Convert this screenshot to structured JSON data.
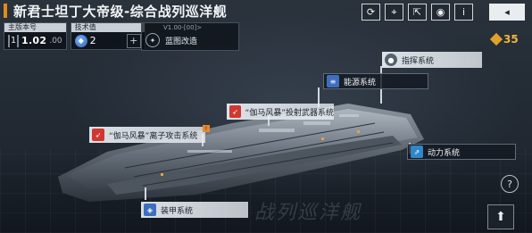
{
  "title": "新君士坦丁大帝级-综合战列巡洋舰",
  "stats": {
    "version_label": "主版本号",
    "level": "1",
    "version_main": "1.02",
    "version_minor": ".00",
    "tech_label": "技术值",
    "tech_value": "2",
    "plus": "+"
  },
  "blueprint": {
    "code": "V1.00-[00]>",
    "label": "蓝图改造"
  },
  "top_buttons": {
    "refresh": "⟳",
    "camera": "⌖",
    "share": "⇱",
    "view": "◉",
    "info": "i",
    "back": "◂"
  },
  "currency": {
    "value": "35",
    "color": "#f3b53a"
  },
  "systems": {
    "command": "指挥系统",
    "energy": "能源系统",
    "projectile": "“伽马风暴”投射武器系统",
    "ion": "“伽马风暴”离子攻击系统",
    "propulsion": "动力系统",
    "armor": "装甲系统"
  },
  "floor_text": "战列巡洋舰",
  "help": "?",
  "colors": {
    "accent": "#e28a1c",
    "panel": "#e9edf0"
  }
}
